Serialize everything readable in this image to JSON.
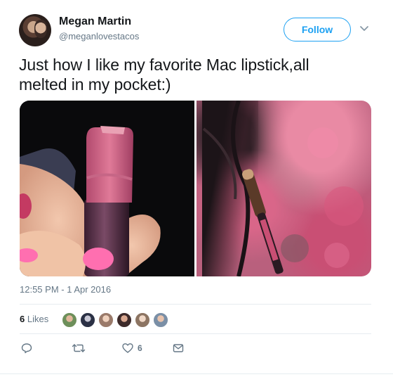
{
  "user": {
    "name": "Megan Martin",
    "handle": "@meganlovestacos",
    "avatar_icon": "user-avatar"
  },
  "header": {
    "follow_label": "Follow",
    "caret_icon": "chevron-down-icon"
  },
  "tweet": {
    "text_line1": "Just how I like my favorite Mac lipstick,all",
    "text_line2": "melted in my pocket:)",
    "timestamp": "12:55 PM - 1 Apr 2016"
  },
  "media": {
    "images": [
      {
        "icon": "lipstick-photo"
      },
      {
        "icon": "melted-lipstick-pocket-photo"
      }
    ]
  },
  "stats": {
    "likes_count": "6",
    "likes_label": "Likes"
  },
  "actions": {
    "reply_icon": "reply-icon",
    "retweet_icon": "retweet-icon",
    "like_icon": "heart-icon",
    "like_count": "6",
    "message_icon": "envelope-icon"
  },
  "colors": {
    "accent": "#1da1f2",
    "secondary_text": "#657786",
    "primary_text": "#14171a",
    "divider": "#e6ecf0"
  }
}
